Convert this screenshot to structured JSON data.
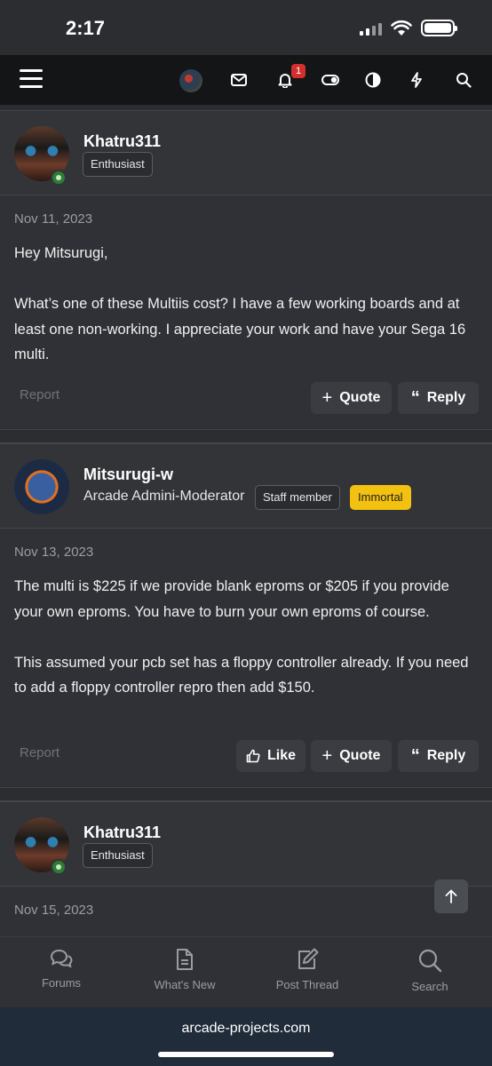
{
  "status_bar": {
    "time": "2:17"
  },
  "nav": {
    "notification_count": "1",
    "icons": [
      "menu-icon",
      "user-avatar",
      "envelope-icon",
      "bell-icon",
      "toggle-icon",
      "contrast-icon",
      "bolt-icon",
      "search-icon"
    ]
  },
  "posts": [
    {
      "username": "Khatru311",
      "user_badge": "Enthusiast",
      "date": "Nov 11, 2023",
      "body": [
        "Hey Mitsurugi,",
        "What’s one of these Multiis cost? I have a few working boards and at least one non-working. I appreciate your work and have your Sega 16 multi."
      ],
      "report": "Report",
      "quote": "Quote",
      "reply": "Reply"
    },
    {
      "username": "Mitsurugi-w",
      "user_title": "Arcade Admini-Moderator",
      "staff_badge": "Staff member",
      "rank_badge": "Immortal",
      "date": "Nov 13, 2023",
      "body": [
        "The multi is $225 if we provide blank eproms or $205 if you provide your own eproms. You have to burn your own eproms of course.",
        "This assumed your pcb set has a floppy controller already. If you need to add a floppy controller repro then add $150."
      ],
      "report": "Report",
      "like": "Like",
      "quote": "Quote",
      "reply": "Reply"
    },
    {
      "username": "Khatru311",
      "user_badge": "Enthusiast",
      "date": "Nov 15, 2023"
    }
  ],
  "tabbar": {
    "forums": "Forums",
    "whats_new": "What's New",
    "post_thread": "Post Thread",
    "search": "Search"
  },
  "url": "arcade-projects.com",
  "colors": {
    "background": "#2b2d31",
    "nav": "#141517",
    "online": "#2e7d32",
    "immortal": "#f3c10f",
    "notification": "#d32f2f"
  }
}
